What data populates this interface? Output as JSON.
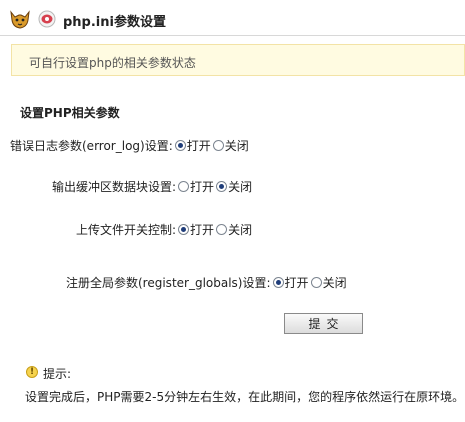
{
  "header": {
    "title": "php.ini参数设置",
    "logo_icon": "tomcat-cat-icon",
    "php_icon": "php-icon"
  },
  "notice": {
    "text": "可自行设置php的相关参数状态"
  },
  "section": {
    "title": "设置PHP相关参数"
  },
  "settings": [
    {
      "label": "错误日志参数(error_log)设置:",
      "options": [
        "打开",
        "关闭"
      ],
      "selected": "打开"
    },
    {
      "label": "输出缓冲区数据块设置:",
      "options": [
        "打开",
        "关闭"
      ],
      "selected": "关闭"
    },
    {
      "label": "上传文件开关控制:",
      "options": [
        "打开",
        "关闭"
      ],
      "selected": "打开"
    },
    {
      "label": "注册全局参数(register_globals)设置:",
      "options": [
        "打开",
        "关闭"
      ],
      "selected": "打开"
    }
  ],
  "submit": {
    "label": "提交"
  },
  "tip": {
    "icon": "exclamation-icon",
    "title": "提示:",
    "body": "设置完成后，PHP需要2-5分钟左右生效，在此期间，您的程序依然运行在原环境。"
  }
}
